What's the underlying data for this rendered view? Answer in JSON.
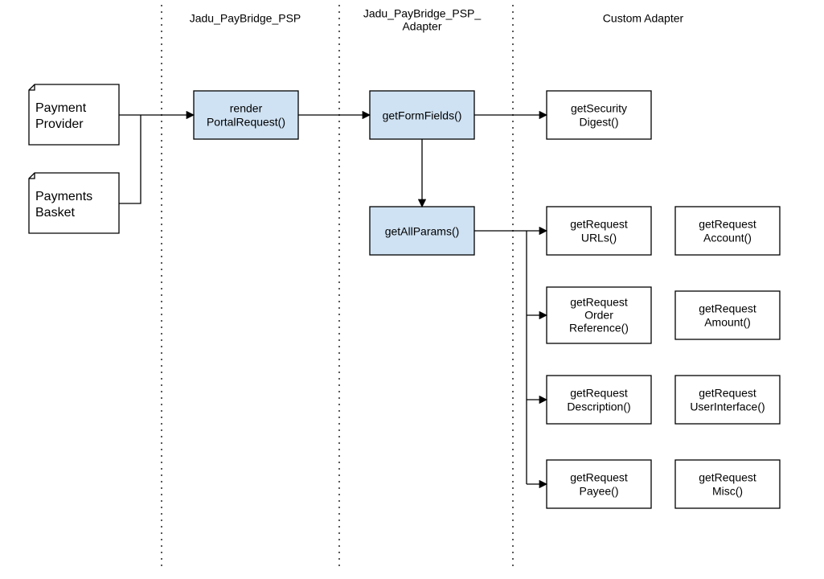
{
  "lanes": {
    "psp": "Jadu_PayBridge_PSP",
    "adapter_top": "Jadu_PayBridge_PSP_",
    "adapter_bot": "Adapter",
    "custom": "Custom Adapter"
  },
  "nodes": {
    "provider_l1": "Payment",
    "provider_l2": "Provider",
    "basket_l1": "Payments",
    "basket_l2": "Basket",
    "render_l1": "render",
    "render_l2": "PortalRequest()",
    "getFormFields": "getFormFields()",
    "getSecurity_l1": "getSecurity",
    "getSecurity_l2": "Digest()",
    "getAllParams": "getAllParams()",
    "urls_l1": "getRequest",
    "urls_l2": "URLs()",
    "account_l1": "getRequest",
    "account_l2": "Account()",
    "order_l1": "getRequest",
    "order_l2": "Order",
    "order_l3": "Reference()",
    "amount_l1": "getRequest",
    "amount_l2": "Amount()",
    "desc_l1": "getRequest",
    "desc_l2": "Description()",
    "ui_l1": "getRequest",
    "ui_l2": "UserInterface()",
    "payee_l1": "getRequest",
    "payee_l2": "Payee()",
    "misc_l1": "getRequest",
    "misc_l2": "Misc()"
  }
}
